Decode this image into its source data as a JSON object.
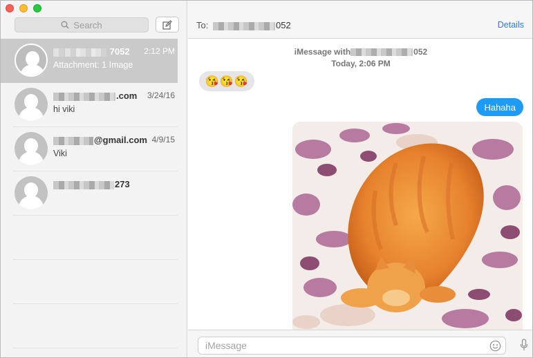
{
  "sidebar": {
    "search_placeholder": "Search",
    "conversations": [
      {
        "name": "7052",
        "date": "2:12 PM",
        "preview": "Attachment: 1 Image",
        "selected": true
      },
      {
        "name": ".com",
        "date": "3/24/16",
        "preview": "hi viki"
      },
      {
        "name": "@gmail.com",
        "date": "4/9/15",
        "preview": "Viki"
      },
      {
        "name": "273",
        "date": "",
        "preview": ""
      }
    ]
  },
  "header": {
    "to_label": "To:",
    "to_value": "052",
    "details_label": "Details"
  },
  "thread": {
    "service_line": "iMessage with",
    "service_suffix": "052",
    "timestamp": "Today, 2:06 PM",
    "incoming_emoji": "😘😘😘",
    "outgoing_text": "Hahaha"
  },
  "composer": {
    "placeholder": "iMessage"
  },
  "colors": {
    "accent": "#1e9cf5",
    "link": "#2a7ae2",
    "incoming_bubble": "#e5e5ea"
  }
}
